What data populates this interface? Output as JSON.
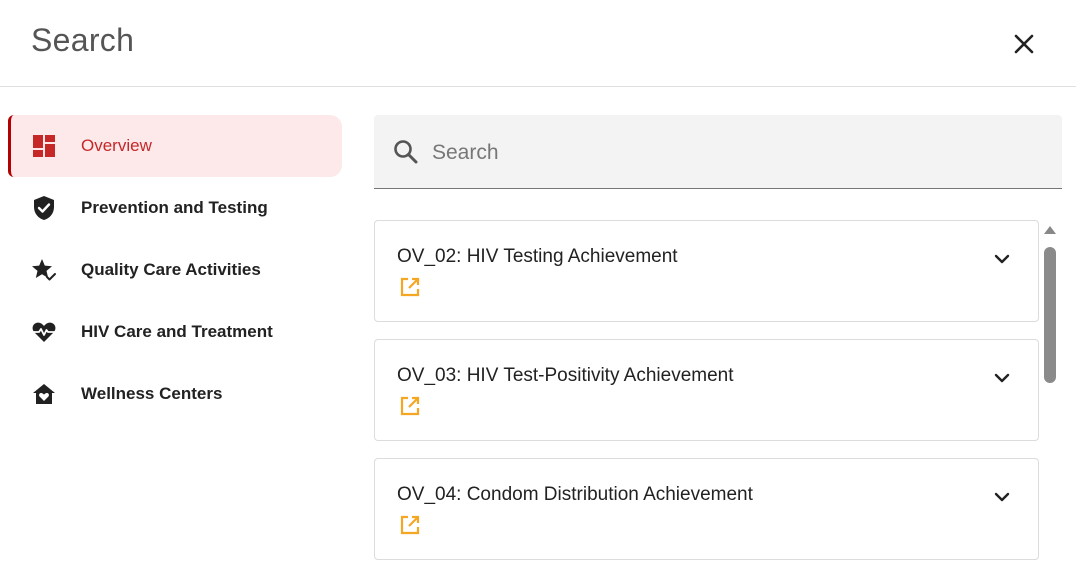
{
  "modal": {
    "title": "Search",
    "close_icon": "close-icon"
  },
  "sidebar": {
    "items": [
      {
        "label": "Overview",
        "icon": "dashboard-icon",
        "active": true
      },
      {
        "label": "Prevention and Testing",
        "icon": "shield-check-icon",
        "active": false
      },
      {
        "label": "Quality Care Activities",
        "icon": "star-check-icon",
        "active": false
      },
      {
        "label": "HIV Care and Treatment",
        "icon": "heartbeat-icon",
        "active": false
      },
      {
        "label": "Wellness Centers",
        "icon": "home-heart-icon",
        "active": false
      }
    ]
  },
  "search": {
    "placeholder": "Search",
    "value": ""
  },
  "results": [
    {
      "title": "OV_02: HIV Testing Achievement"
    },
    {
      "title": "OV_03: HIV Test-Positivity Achievement"
    },
    {
      "title": "OV_04: Condom Distribution Achievement"
    }
  ],
  "colors": {
    "active_accent": "#b30000",
    "active_text": "#c62828",
    "active_bg": "#fde8ea",
    "link_icon": "#f5a623"
  }
}
